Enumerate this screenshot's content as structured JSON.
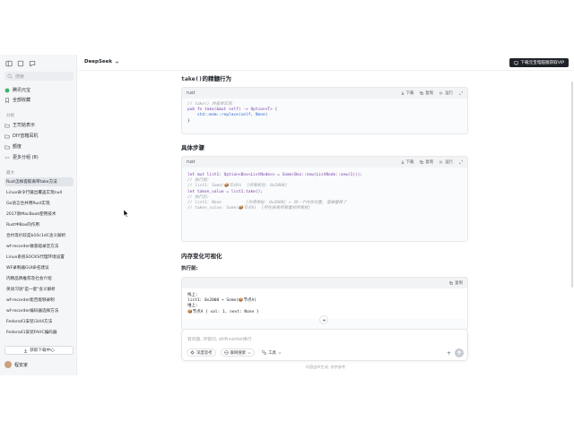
{
  "sidebar": {
    "search_placeholder": "搜索",
    "nav": [
      {
        "label": "腾讯元宝",
        "icon": "yuanbao-icon"
      },
      {
        "label": "全部收藏",
        "icon": "bookmark-icon"
      }
    ],
    "groups_label": "分组",
    "groups": [
      {
        "label": "王司铭表示",
        "icon": "folder-icon"
      },
      {
        "label": "DIY音箱耳机",
        "icon": "folder-icon"
      },
      {
        "label": "额度",
        "icon": "folder-icon"
      },
      {
        "label": "更多分组 (8)",
        "icon": "more-icon"
      }
    ],
    "recent_label": "最大",
    "chats": [
      "Rust怎样提取离带take方法",
      "Linux命令行输出覆盖实现null",
      "Go语言合并用Rust实现",
      "2017款MacBook使用技术",
      "Rust中Box的作用",
      "合约等价较是b10c1dC含义解析",
      "wf-recorder做基础录音方法",
      "Linux系统SOCKS代理环境设置",
      "WF录制器GUI命名建议",
      "内精品牌推荐及社会介绍",
      "英语习语\"是一套\"含义解析",
      "wf-recorder能否能够录制",
      "wf-recorder编码器选择方法",
      "Fedora41安装i3i44方法",
      "Fedora41安装FAHC编码器"
    ],
    "download_label": "获取下载中心",
    "user_name": "程安家"
  },
  "topbar": {
    "model": "DeepSeek",
    "vip_label": "下载元宝电脑版获取VIP"
  },
  "sections": {
    "take_title_code": "take()",
    "take_title_rest": "的精髓行为",
    "steps_title": "具体步骤",
    "mem_title": "内存变化可视化",
    "before_label": "执行前:"
  },
  "code_actions": {
    "download": "下载",
    "copy": "复制",
    "run": "运行"
  },
  "code1": {
    "lang": "rust",
    "lines": [
      "// take() 的简单实现",
      "pub fn take(&mut self) -> Option<T> {",
      "    std::mem::replace(self, None)",
      "}"
    ]
  },
  "code2": {
    "lang": "rust",
    "lines": [
      "let mut list1: Option<Box<ListNode>> = Some(Box::new(ListNode::new(1)));",
      "",
      "// 执行前:",
      "// list1: Some(📦节点A)  [所有权在: 0x2000]",
      "",
      "let taken_value = list1.take();",
      "",
      "// 执行后:",
      "// list1: None          [作用地址: 0x2000] ← 同一个内存位置, 值被替换了",
      "// taken_value: Some(📦节点A)  [所在原来所有者的所有权]"
    ]
  },
  "code3": {
    "copy": "复制",
    "lines": [
      "栈上:",
      "list1: 0x2000 → Some(📦节点A)",
      "",
      "堆上:",
      "📦节点A { val: 1, next: None }"
    ]
  },
  "input": {
    "placeholder": "有问题, 尽管问, shift+enter换行",
    "deep_think": "深度思考",
    "web_search": "联网搜索",
    "tools": "工具"
  },
  "footer_note": "内容由AI生成, 仅供参考"
}
